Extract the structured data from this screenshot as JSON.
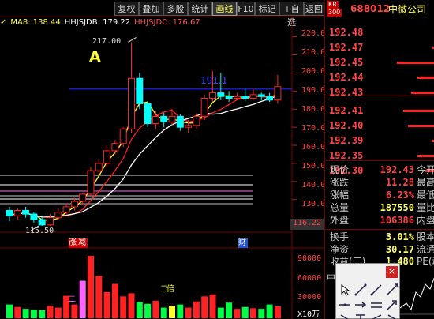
{
  "toolbar": {
    "buttons": [
      "复权",
      "叠加",
      "多股",
      "统计",
      "画线",
      "F10",
      "标记",
      "+自选",
      "返回"
    ],
    "active_index": 4
  },
  "indicators": {
    "check_mark": "✓",
    "ma8": "MA8: 138.44",
    "hhjsjdb": "HHJSJDB: 179.22",
    "hhjsjdc": "HHJSJDC: 176.67"
  },
  "chart_labels": {
    "high_price": "217.00",
    "low_price": "115.50",
    "signal_letter": "A",
    "ref_price": "191.1",
    "current_axis_price": "116.22",
    "marker_zhang": "涨",
    "marker_jian": "减",
    "marker_cai": "财",
    "vol_marker_er": "二",
    "vol_marker_bei": "倍",
    "vol_unit": "X10万"
  },
  "axis_y": [
    "220.0",
    "210.0",
    "200.0",
    "190.0",
    "180.0",
    "170.0",
    "160.0",
    "150.0",
    "140.0",
    "130.0"
  ],
  "vol_axis": [
    "90000",
    "60000",
    "30000"
  ],
  "colors": {
    "up": "#ff2222",
    "down": "#00ffff",
    "ma_yellow": "#ffff33",
    "ma_white": "#ffffff",
    "ma_red": "#ff2222",
    "ref_line": "#2222ff"
  },
  "chart_data": {
    "type": "candlestick",
    "candles": [
      {
        "o": 124,
        "c": 121,
        "h": 126,
        "l": 118
      },
      {
        "o": 121,
        "c": 124,
        "h": 125,
        "l": 119
      },
      {
        "o": 124,
        "c": 122,
        "h": 126,
        "l": 120
      },
      {
        "o": 122,
        "c": 119,
        "h": 123,
        "l": 117
      },
      {
        "o": 119,
        "c": 116,
        "h": 120,
        "l": 115.5
      },
      {
        "o": 116,
        "c": 120,
        "h": 122,
        "l": 115.5
      },
      {
        "o": 120,
        "c": 123,
        "h": 125,
        "l": 119
      },
      {
        "o": 123,
        "c": 126,
        "h": 128,
        "l": 122
      },
      {
        "o": 126,
        "c": 129,
        "h": 131,
        "l": 124
      },
      {
        "o": 129,
        "c": 133,
        "h": 134,
        "l": 127
      },
      {
        "o": 133,
        "c": 146,
        "h": 148,
        "l": 132
      },
      {
        "o": 146,
        "c": 150,
        "h": 152,
        "l": 144
      },
      {
        "o": 150,
        "c": 157,
        "h": 160,
        "l": 148
      },
      {
        "o": 157,
        "c": 161,
        "h": 163,
        "l": 155
      },
      {
        "o": 161,
        "c": 169,
        "h": 170,
        "l": 159
      },
      {
        "o": 169,
        "c": 197,
        "h": 217,
        "l": 167
      },
      {
        "o": 197,
        "c": 183,
        "h": 200,
        "l": 180
      },
      {
        "o": 183,
        "c": 172,
        "h": 184,
        "l": 170
      },
      {
        "o": 172,
        "c": 176,
        "h": 179,
        "l": 169
      },
      {
        "o": 176,
        "c": 173,
        "h": 178,
        "l": 170
      },
      {
        "o": 173,
        "c": 176,
        "h": 180,
        "l": 171
      },
      {
        "o": 176,
        "c": 170,
        "h": 177,
        "l": 168
      },
      {
        "o": 170,
        "c": 171,
        "h": 174,
        "l": 167
      },
      {
        "o": 171,
        "c": 176,
        "h": 178,
        "l": 169
      },
      {
        "o": 176,
        "c": 186,
        "h": 188,
        "l": 174
      },
      {
        "o": 186,
        "c": 189,
        "h": 201,
        "l": 184
      },
      {
        "o": 189,
        "c": 187,
        "h": 200,
        "l": 185
      },
      {
        "o": 187,
        "c": 186,
        "h": 190,
        "l": 184
      },
      {
        "o": 186,
        "c": 187,
        "h": 189,
        "l": 185
      },
      {
        "o": 187,
        "c": 186,
        "h": 191,
        "l": 184
      },
      {
        "o": 186,
        "c": 188,
        "h": 191,
        "l": 185
      },
      {
        "o": 188,
        "c": 187,
        "h": 189,
        "l": 185
      },
      {
        "o": 187,
        "c": 185,
        "h": 189,
        "l": 184
      },
      {
        "o": 185,
        "c": 192.43,
        "h": 199,
        "l": 183
      }
    ],
    "volume": [
      22000,
      18000,
      15000,
      14000,
      13000,
      20000,
      17000,
      36000,
      22000,
      60000,
      100000,
      68000,
      42000,
      55000,
      35000,
      40000,
      26000,
      23000,
      28000,
      17000,
      20000,
      22000,
      17000,
      27000,
      35000,
      38000,
      17000,
      25000,
      15000,
      18000,
      16000,
      15000,
      22000,
      19000
    ],
    "order_book": [
      {
        "price": "192.48",
        "size": 1
      },
      {
        "price": "192.47",
        "size": 3
      },
      {
        "price": "192.45",
        "size": 48
      },
      {
        "price": "192.44",
        "size": 22
      },
      {
        "price": "192.43",
        "size": 30
      },
      {
        "price": "192.41",
        "size": 40
      },
      {
        "price": "192.40",
        "size": 34
      },
      {
        "price": "192.39",
        "size": 4
      },
      {
        "price": "192.35",
        "size": 22
      },
      {
        "price": "192.30",
        "size": 12
      }
    ]
  },
  "quote_header": {
    "badge_top": "KR",
    "badge_bottom": "300",
    "code": "688012",
    "name": "中微公司"
  },
  "quotes": [
    {
      "key": "现价",
      "value": "192.43",
      "color": "#ff4444",
      "key2": "今开"
    },
    {
      "key": "涨跌",
      "value": "11.28",
      "color": "#ff4444",
      "key2": "最高"
    },
    {
      "key": "涨幅",
      "value": "6.23%",
      "color": "#ff4444",
      "key2": "最低"
    },
    {
      "key": "总量",
      "value": "187550",
      "color": "#ffff66",
      "key2": "量比"
    },
    {
      "key": "外盘",
      "value": "106386",
      "color": "#ff4444",
      "key2": "内盘"
    },
    {
      "key": "换手",
      "value": "3.01%",
      "color": "#ffff66",
      "key2": "股本"
    },
    {
      "key": "净资",
      "value": "30.17",
      "color": "#ffff66",
      "key2": "流通"
    },
    {
      "key": "收益(三)",
      "value": "1.480",
      "color": "#ffff66",
      "key2": "PE(动"
    }
  ],
  "popup": {
    "close": "×",
    "bottom_label": "中"
  }
}
